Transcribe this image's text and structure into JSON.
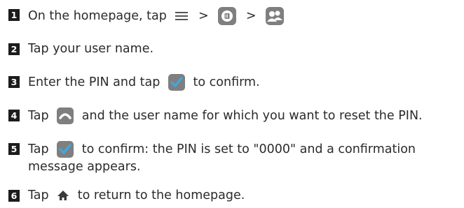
{
  "steps": [
    {
      "n": "1",
      "a": "On the homepage, tap",
      "sep1": ">",
      "sep2": ">"
    },
    {
      "n": "2",
      "a": "Tap your user name."
    },
    {
      "n": "3",
      "a": "Enter the PIN and tap",
      "b": "to confirm."
    },
    {
      "n": "4",
      "a": "Tap",
      "b": "and the user name for which you want to reset the PIN."
    },
    {
      "n": "5",
      "a": "Tap",
      "b": "to confirm: the PIN is set to \"0000\" and a confirmation message appears."
    },
    {
      "n": "6",
      "a": "Tap",
      "b": "to return to the homepage."
    }
  ],
  "icons": {
    "menu": "menu-icon",
    "settings": "device-settings-icon",
    "users": "users-icon",
    "confirm": "checkmark-icon",
    "reset": "reset-pin-icon",
    "home": "home-icon"
  },
  "colors": {
    "badge": "#1c1c1c",
    "icon_bg": "#7f7f7f",
    "check": "#3fa9e0"
  }
}
